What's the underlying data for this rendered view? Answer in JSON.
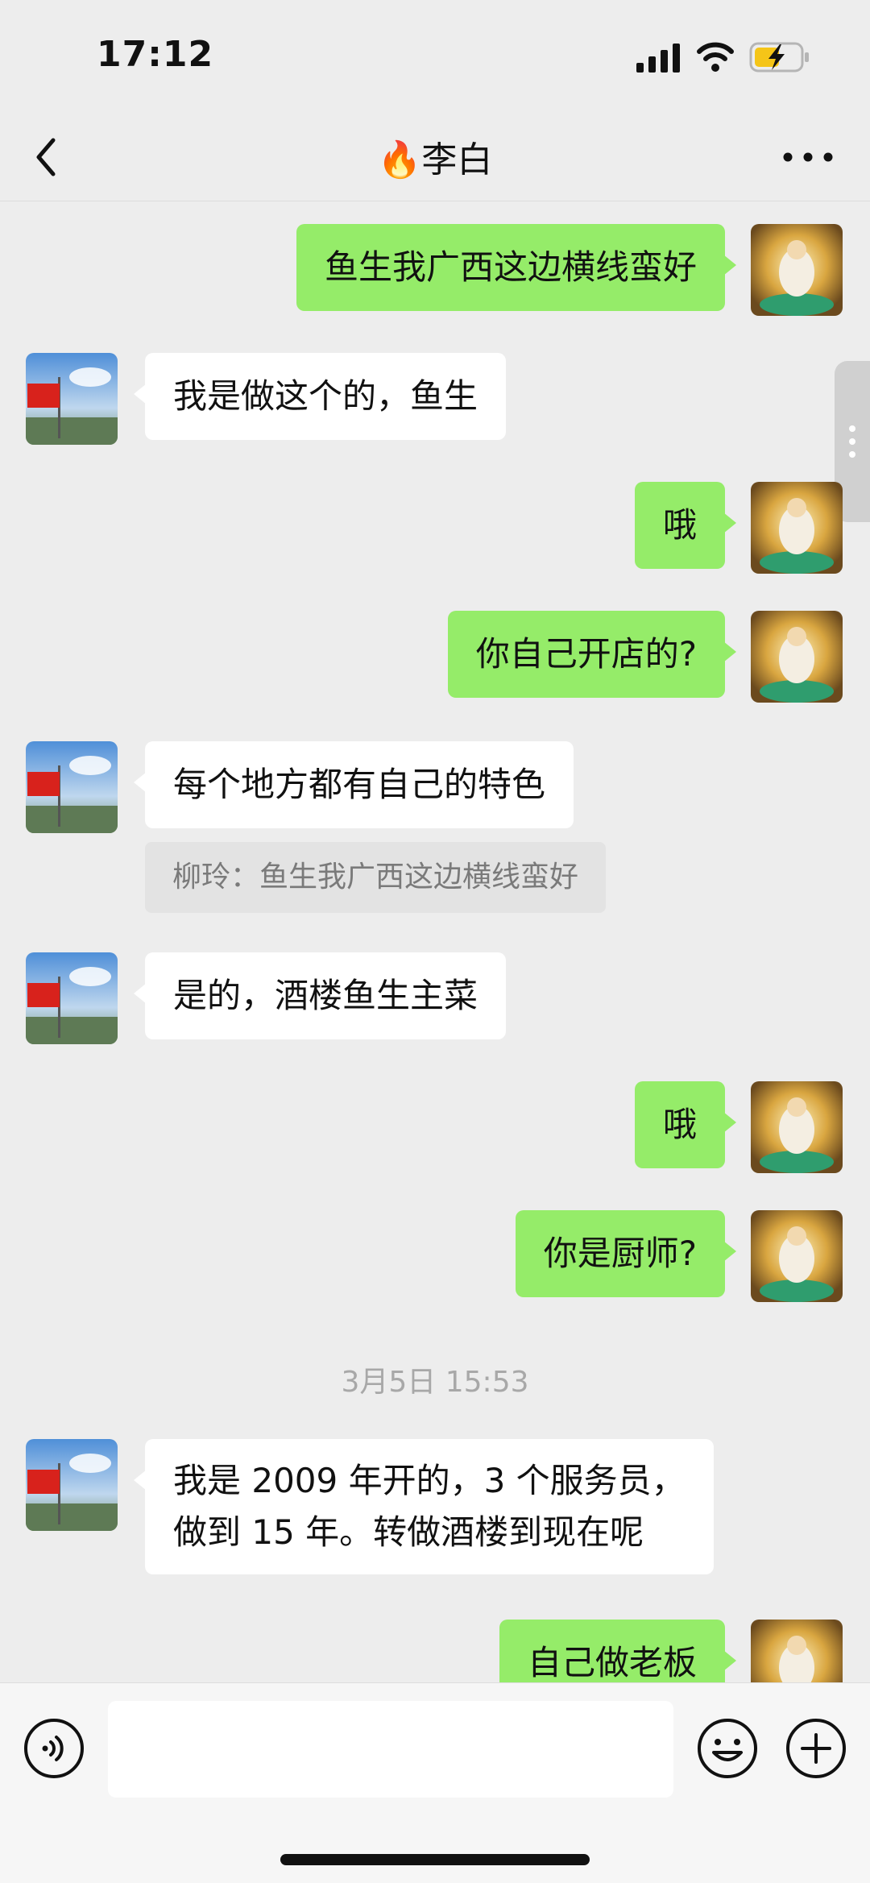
{
  "status_bar": {
    "time": "17:12"
  },
  "nav": {
    "title": "🔥李白"
  },
  "messages": [
    {
      "side": "right",
      "text": "鱼生我广西这边横线蛮好"
    },
    {
      "side": "left",
      "text": "我是做这个的，鱼生"
    },
    {
      "side": "right",
      "text": "哦"
    },
    {
      "side": "right",
      "text": "你自己开店的?"
    },
    {
      "side": "left",
      "text": "每个地方都有自己的特色",
      "quote": "柳玲：鱼生我广西这边横线蛮好"
    },
    {
      "side": "left",
      "text": "是的，酒楼鱼生主菜"
    },
    {
      "side": "right",
      "text": "哦"
    },
    {
      "side": "right",
      "text": "你是厨师?"
    },
    {
      "side": "left",
      "text_lines": [
        "我是 2009 年开的，3 个服务员，",
        "做到 15 年。转做酒楼到现在呢"
      ]
    },
    {
      "side": "right",
      "text": "自己做老板"
    }
  ],
  "timestamp": "3月5日 15:53",
  "input": {
    "placeholder": ""
  },
  "colors": {
    "background": "#EDEDED",
    "bubble_self": "#95EC69",
    "bubble_other": "#FFFFFF"
  }
}
